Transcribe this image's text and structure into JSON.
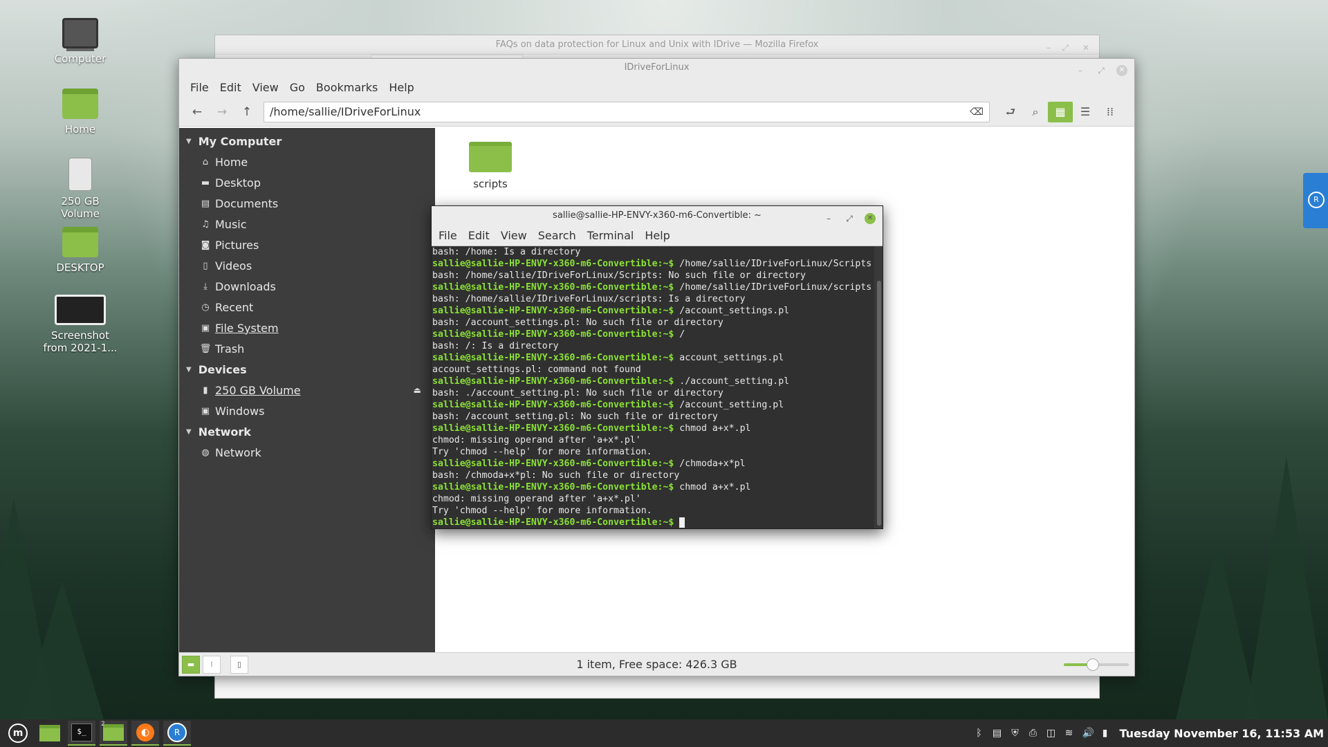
{
  "desktop": {
    "icons": [
      {
        "label": "Computer"
      },
      {
        "label": "Home"
      },
      {
        "label": "250 GB\nVolume"
      },
      {
        "label": "DESKTOP"
      },
      {
        "label": "Screenshot\nfrom 2021-1..."
      }
    ]
  },
  "firefox": {
    "title": "FAQs on data protection for Linux and Unix with IDrive — Mozilla Firefox"
  },
  "file_manager": {
    "title": "IDriveForLinux",
    "menu": [
      "File",
      "Edit",
      "View",
      "Go",
      "Bookmarks",
      "Help"
    ],
    "path": "/home/sallie/IDriveForLinux",
    "sidebar": {
      "sections": [
        {
          "label": "My Computer",
          "items": [
            {
              "label": "Home",
              "icon": "home-icon"
            },
            {
              "label": "Desktop",
              "icon": "desktop-icon"
            },
            {
              "label": "Documents",
              "icon": "document-icon"
            },
            {
              "label": "Music",
              "icon": "music-icon"
            },
            {
              "label": "Pictures",
              "icon": "camera-icon"
            },
            {
              "label": "Videos",
              "icon": "film-icon"
            },
            {
              "label": "Downloads",
              "icon": "download-icon"
            },
            {
              "label": "Recent",
              "icon": "clock-icon"
            },
            {
              "label": "File System",
              "icon": "drive-icon"
            },
            {
              "label": "Trash",
              "icon": "trash-icon"
            }
          ]
        },
        {
          "label": "Devices",
          "items": [
            {
              "label": "250 GB Volume",
              "icon": "usb-icon"
            },
            {
              "label": "Windows",
              "icon": "drive-icon"
            }
          ]
        },
        {
          "label": "Network",
          "items": [
            {
              "label": "Network",
              "icon": "globe-icon"
            }
          ]
        }
      ]
    },
    "files": [
      {
        "name": "scripts"
      }
    ],
    "status": "1 item, Free space: 426.3 GB",
    "zoom_fraction": 0.45
  },
  "terminal": {
    "title": "sallie@sallie-HP-ENVY-x360-m6-Convertible: ~",
    "menu": [
      "File",
      "Edit",
      "View",
      "Search",
      "Terminal",
      "Help"
    ],
    "prompt": "sallie@sallie-HP-ENVY-x360-m6-Convertible:~$",
    "lines": [
      {
        "type": "out",
        "text": "bash: /home: Is a directory"
      },
      {
        "type": "cmd",
        "text": " /home/sallie/IDriveForLinux/Scripts"
      },
      {
        "type": "out",
        "text": "bash: /home/sallie/IDriveForLinux/Scripts: No such file or directory"
      },
      {
        "type": "cmd",
        "text": " /home/sallie/IDriveForLinux/scripts"
      },
      {
        "type": "out",
        "text": "bash: /home/sallie/IDriveForLinux/scripts: Is a directory"
      },
      {
        "type": "cmd",
        "text": " /account_settings.pl"
      },
      {
        "type": "out",
        "text": "bash: /account_settings.pl: No such file or directory"
      },
      {
        "type": "cmd",
        "text": " /"
      },
      {
        "type": "out",
        "text": "bash: /: Is a directory"
      },
      {
        "type": "cmd",
        "text": " account_settings.pl"
      },
      {
        "type": "out",
        "text": "account_settings.pl: command not found"
      },
      {
        "type": "cmd",
        "text": " ./account_setting.pl"
      },
      {
        "type": "out",
        "text": "bash: ./account_setting.pl: No such file or directory"
      },
      {
        "type": "cmd",
        "text": " /account_setting.pl"
      },
      {
        "type": "out",
        "text": "bash: /account_setting.pl: No such file or directory"
      },
      {
        "type": "cmd",
        "text": " chmod a+x*.pl"
      },
      {
        "type": "out",
        "text": "chmod: missing operand after 'a+x*.pl'"
      },
      {
        "type": "out",
        "text": "Try 'chmod --help' for more information."
      },
      {
        "type": "cmd",
        "text": " /chmoda+x*pl"
      },
      {
        "type": "out",
        "text": "bash: /chmoda+x*pl: No such file or directory"
      },
      {
        "type": "cmd",
        "text": " chmod a+x*.pl"
      },
      {
        "type": "out",
        "text": "chmod: missing operand after 'a+x*.pl'"
      },
      {
        "type": "out",
        "text": "Try 'chmod --help' for more information."
      },
      {
        "type": "cur",
        "text": " "
      }
    ]
  },
  "taskbar": {
    "workspace_badge": "2",
    "clock": "Tuesday November 16, 11:53 AM"
  },
  "colors": {
    "accent": "#8bbf4a",
    "prompt": "#8ae234",
    "idrive": "#2a7fd4"
  }
}
